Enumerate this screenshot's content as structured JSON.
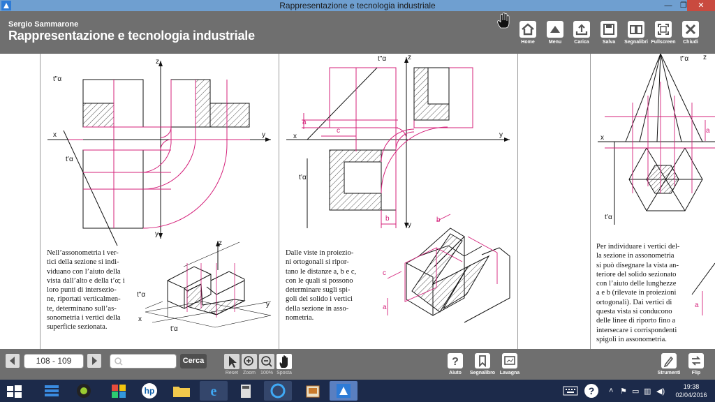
{
  "window": {
    "title": "Rappresentazione e tecnologia industriale",
    "minimize": "—",
    "restore": "❐",
    "close": "✕"
  },
  "header": {
    "author": "Sergio Sammarone",
    "book_title": "Rappresentazione e tecnologia industriale",
    "buttons": [
      {
        "label": "Home",
        "icon": "home-icon"
      },
      {
        "label": "Menu",
        "icon": "triangle-up-icon"
      },
      {
        "label": "Carica",
        "icon": "upload-icon"
      },
      {
        "label": "Salva",
        "icon": "floppy-icon"
      },
      {
        "label": "Segnalibri",
        "icon": "book-icon"
      },
      {
        "label": "Fullscreen",
        "icon": "fullscreen-icon"
      },
      {
        "label": "Chiudi",
        "icon": "close-icon"
      }
    ]
  },
  "pages": {
    "left": {
      "text": [
        "Nell’assonometria i ver-",
        "tici della sezione si indi-",
        "viduano con l’aiuto della",
        "vista dall’alto e della t’α; i",
        "loro punti di interseziо-",
        "ne, riportati verticalmen-",
        "te, determinano sull’as-",
        "sonometria i vertici della",
        "superficie sezionata."
      ],
      "labels": {
        "z": "z",
        "x": "x",
        "y": "y",
        "t2": "t\"α",
        "t1": "t’α",
        "z2": "z",
        "x2": "x",
        "y2": "y",
        "t2b": "t\"α",
        "t1b": "t’α"
      }
    },
    "middle": {
      "text": [
        "Dalle viste in proiezio-",
        "ni ortogonali si ripor-",
        "tano le distanze a, b e c,",
        "con le quali si possono",
        "determinare sugli spi-",
        "goli del solido i vertici",
        "della sezione in asso-",
        "nometria."
      ],
      "labels": {
        "z": "z",
        "x": "x",
        "y": "y",
        "t2": "t\"α",
        "t1": "t’α",
        "a": "a",
        "b": "b",
        "c": "c",
        "y2": "y",
        "b2": "b",
        "c2": "c",
        "a2": "a"
      }
    },
    "right": {
      "text": [
        "Per individuare i vertici del-",
        "la sezione in assonometria",
        "si può disegnare la vista an-",
        "teriore del solido sezionato",
        "con l’aiuto delle lunghezze",
        "a e b (rilevate in proiezioni",
        "ortogonali). Dai vertici di",
        "questa vista si conducono",
        "delle linee di riporto fino a",
        "intersecare i corrispondenti",
        "spigoli in assonometria."
      ],
      "labels": {
        "t2": "t\"α",
        "z": "z",
        "x": "x",
        "t1": "t’α",
        "a": "a",
        "a2": "a"
      }
    }
  },
  "bottombar": {
    "page_indicator": "108 - 109",
    "search_placeholder": "",
    "search_button": "Cerca",
    "tools": [
      {
        "label": "Reset",
        "icon": "pointer-icon"
      },
      {
        "label": "Zoom",
        "icon": "zoom-in-icon"
      },
      {
        "label": "100%",
        "icon": "zoom-out-icon"
      },
      {
        "label": "Sposta",
        "icon": "hand-icon"
      }
    ],
    "right_buttons": [
      {
        "label": "Aiuto",
        "icon": "help-icon"
      },
      {
        "label": "Segnalibro",
        "icon": "bookmark-icon"
      },
      {
        "label": "Lavagna",
        "icon": "whiteboard-icon"
      },
      {
        "label": "Strumenti",
        "icon": "pen-icon"
      },
      {
        "label": "Flip",
        "icon": "flip-icon"
      }
    ]
  },
  "taskbar": {
    "time": "19:38",
    "date": "02/04/2016",
    "apps": [
      "windows-start-icon",
      "stack-icon",
      "webcam-icon",
      "paint-icon",
      "hp-icon",
      "folder-icon",
      "ie-icon",
      "calculator-icon",
      "edge-icon",
      "gallery-icon",
      "book-app-icon"
    ]
  },
  "colors": {
    "titlebar": "#6f9fd0",
    "header": "#6f6f6f",
    "magenta": "#d4217a",
    "taskbar": "#1c2a4a",
    "close": "#c94a3f"
  }
}
